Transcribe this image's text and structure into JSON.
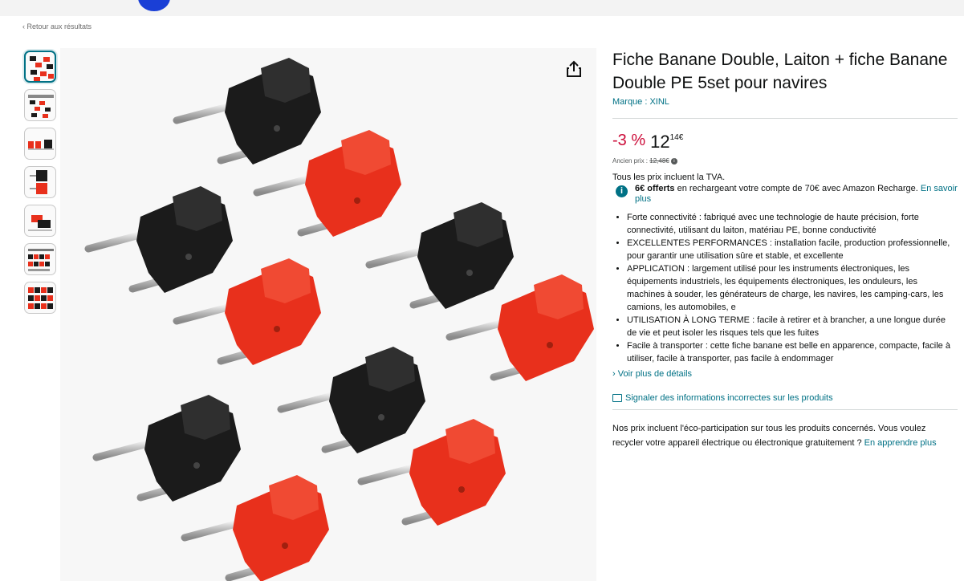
{
  "nav": {
    "back_label": "‹ Retour aux résultats"
  },
  "gallery": {
    "thumbnail_count": 7,
    "share_icon": "share-icon",
    "product_colors": {
      "black": "#1b1b1b",
      "red": "#e8301c",
      "metal": "#c9c9c9"
    }
  },
  "product": {
    "title": "Fiche Banane Double, Laiton + fiche Banane Double PE 5set pour navires",
    "brand": "Marque : XINL",
    "discount": "-3 %",
    "price_whole": "12",
    "price_fraction": "14€",
    "old_price_label": "Ancien prix :",
    "old_price_value": "12,48€",
    "tva_note": "Tous les prix incluent la TVA.",
    "offer_bold": "6€ offerts",
    "offer_text": " en rechargeant votre compte de 70€ avec Amazon Recharge. ",
    "offer_link": "En savoir plus",
    "bullets": [
      "Forte connectivité : fabriqué avec une technologie de haute précision, forte connectivité, utilisant du laiton, matériau PE, bonne conductivité",
      "EXCELLENTES PERFORMANCES : installation facile, production professionnelle, pour garantir une utilisation sûre et stable, et excellente",
      "APPLICATION : largement utilisé pour les instruments électroniques, les équipements industriels, les équipements électroniques, les onduleurs, les machines à souder, les générateurs de charge, les navires, les camping-cars, les camions, les automobiles, e",
      "UTILISATION À LONG TERME : facile à retirer et à brancher, a une longue durée de vie et peut isoler les risques tels que les fuites",
      "Facile à transporter : cette fiche banane est belle en apparence, compacte, facile à utiliser, facile à transporter, pas facile à endommager"
    ],
    "more_details": "› Voir plus de détails",
    "report_label": "Signaler des informations incorrectes sur les produits",
    "eco_text": "Nos prix incluent l'éco-participation sur tous les produits concernés. Vous voulez recycler votre appareil électrique ou électronique gratuitement ? ",
    "eco_link": "En apprendre plus"
  }
}
